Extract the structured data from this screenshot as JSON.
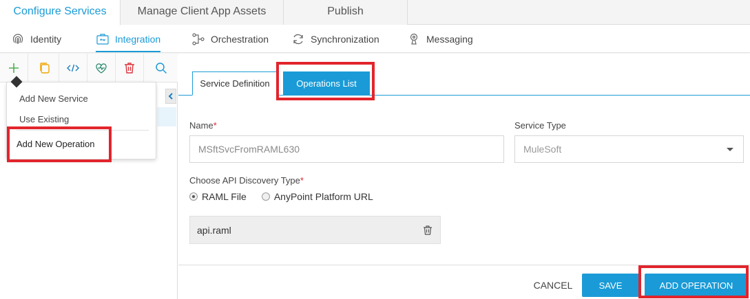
{
  "top_tabs": [
    {
      "label": "Configure Services",
      "active": true
    },
    {
      "label": "Manage Client App Assets",
      "active": false
    },
    {
      "label": "Publish",
      "active": false
    }
  ],
  "sub_nav": [
    {
      "label": "Identity",
      "icon": "fingerprint-icon"
    },
    {
      "label": "Integration",
      "icon": "integration-icon",
      "active": true
    },
    {
      "label": "Orchestration",
      "icon": "orchestration-icon"
    },
    {
      "label": "Synchronization",
      "icon": "sync-icon"
    },
    {
      "label": "Messaging",
      "icon": "messaging-icon"
    }
  ],
  "toolbar_icons": [
    "plus-icon",
    "copy-icon",
    "code-icon",
    "heart-rate-icon",
    "trash-icon",
    "search-icon"
  ],
  "popover": {
    "add_new_service": "Add New Service",
    "use_existing": "Use Existing",
    "add_new_operation": "Add New Operation"
  },
  "content_tabs": {
    "service_definition": "Service Definition",
    "operations_list": "Operations List"
  },
  "form": {
    "name_label": "Name",
    "name_value": "MSftSvcFromRAML630",
    "service_type_label": "Service Type",
    "service_type_value": "MuleSoft",
    "discovery_label": "Choose API Discovery Type",
    "radio_raml": "RAML File",
    "radio_anypoint": "AnyPoint Platform URL",
    "selected_discovery": "RAML File",
    "file_name": "api.raml",
    "required_mark": "*"
  },
  "footer": {
    "cancel": "CANCEL",
    "save": "SAVE",
    "add_operation": "ADD OPERATION"
  },
  "colors": {
    "accent": "#1a9bd7",
    "highlight_red": "#e2242c"
  }
}
